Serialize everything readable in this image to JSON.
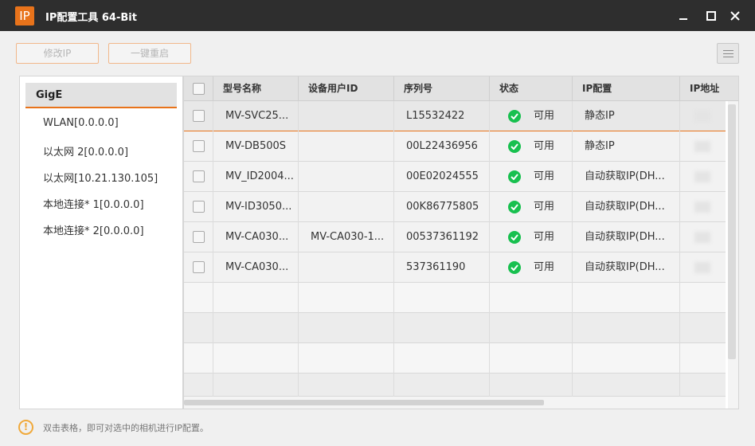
{
  "window": {
    "logo": "IP",
    "title": "IP配置工具 64-Bit"
  },
  "toolbar": {
    "modify_ip_label": "修改IP",
    "reboot_label": "一键重启"
  },
  "sidebar": {
    "category": "GigE",
    "interfaces": [
      "WLAN[0.0.0.0]",
      "以太网 2[0.0.0.0]",
      "以太网[10.21.130.105]",
      "本地连接* 1[0.0.0.0]",
      "本地连接* 2[0.0.0.0]"
    ]
  },
  "table": {
    "columns": [
      "型号名称",
      "设备用户ID",
      "序列号",
      "状态",
      "IP配置",
      "IP地址"
    ],
    "rows": [
      {
        "model": "MV-SVC25...",
        "user_id": "",
        "serial": "L15532422",
        "status": "可用",
        "ip_config": "静态IP"
      },
      {
        "model": "MV-DB500S",
        "user_id": "",
        "serial": "00L22436956",
        "status": "可用",
        "ip_config": "静态IP"
      },
      {
        "model": "MV_ID2004...",
        "user_id": "",
        "serial": "00E02024555",
        "status": "可用",
        "ip_config": "自动获取IP(DH..."
      },
      {
        "model": "MV-ID3050...",
        "user_id": "",
        "serial": "00K86775805",
        "status": "可用",
        "ip_config": "自动获取IP(DH..."
      },
      {
        "model": "MV-CA030...",
        "user_id": "MV-CA030-1...",
        "serial": "00537361192",
        "status": "可用",
        "ip_config": "自动获取IP(DH..."
      },
      {
        "model": "MV-CA030...",
        "user_id": "",
        "serial": "537361190",
        "status": "可用",
        "ip_config": "自动获取IP(DH..."
      }
    ]
  },
  "footer": {
    "info_icon": "!",
    "hint": "双击表格，即可对选中的相机进行IP配置。"
  },
  "colors": {
    "accent": "#e8731b",
    "status_ok": "#18c04f",
    "titlebar": "#2e2e2e"
  }
}
